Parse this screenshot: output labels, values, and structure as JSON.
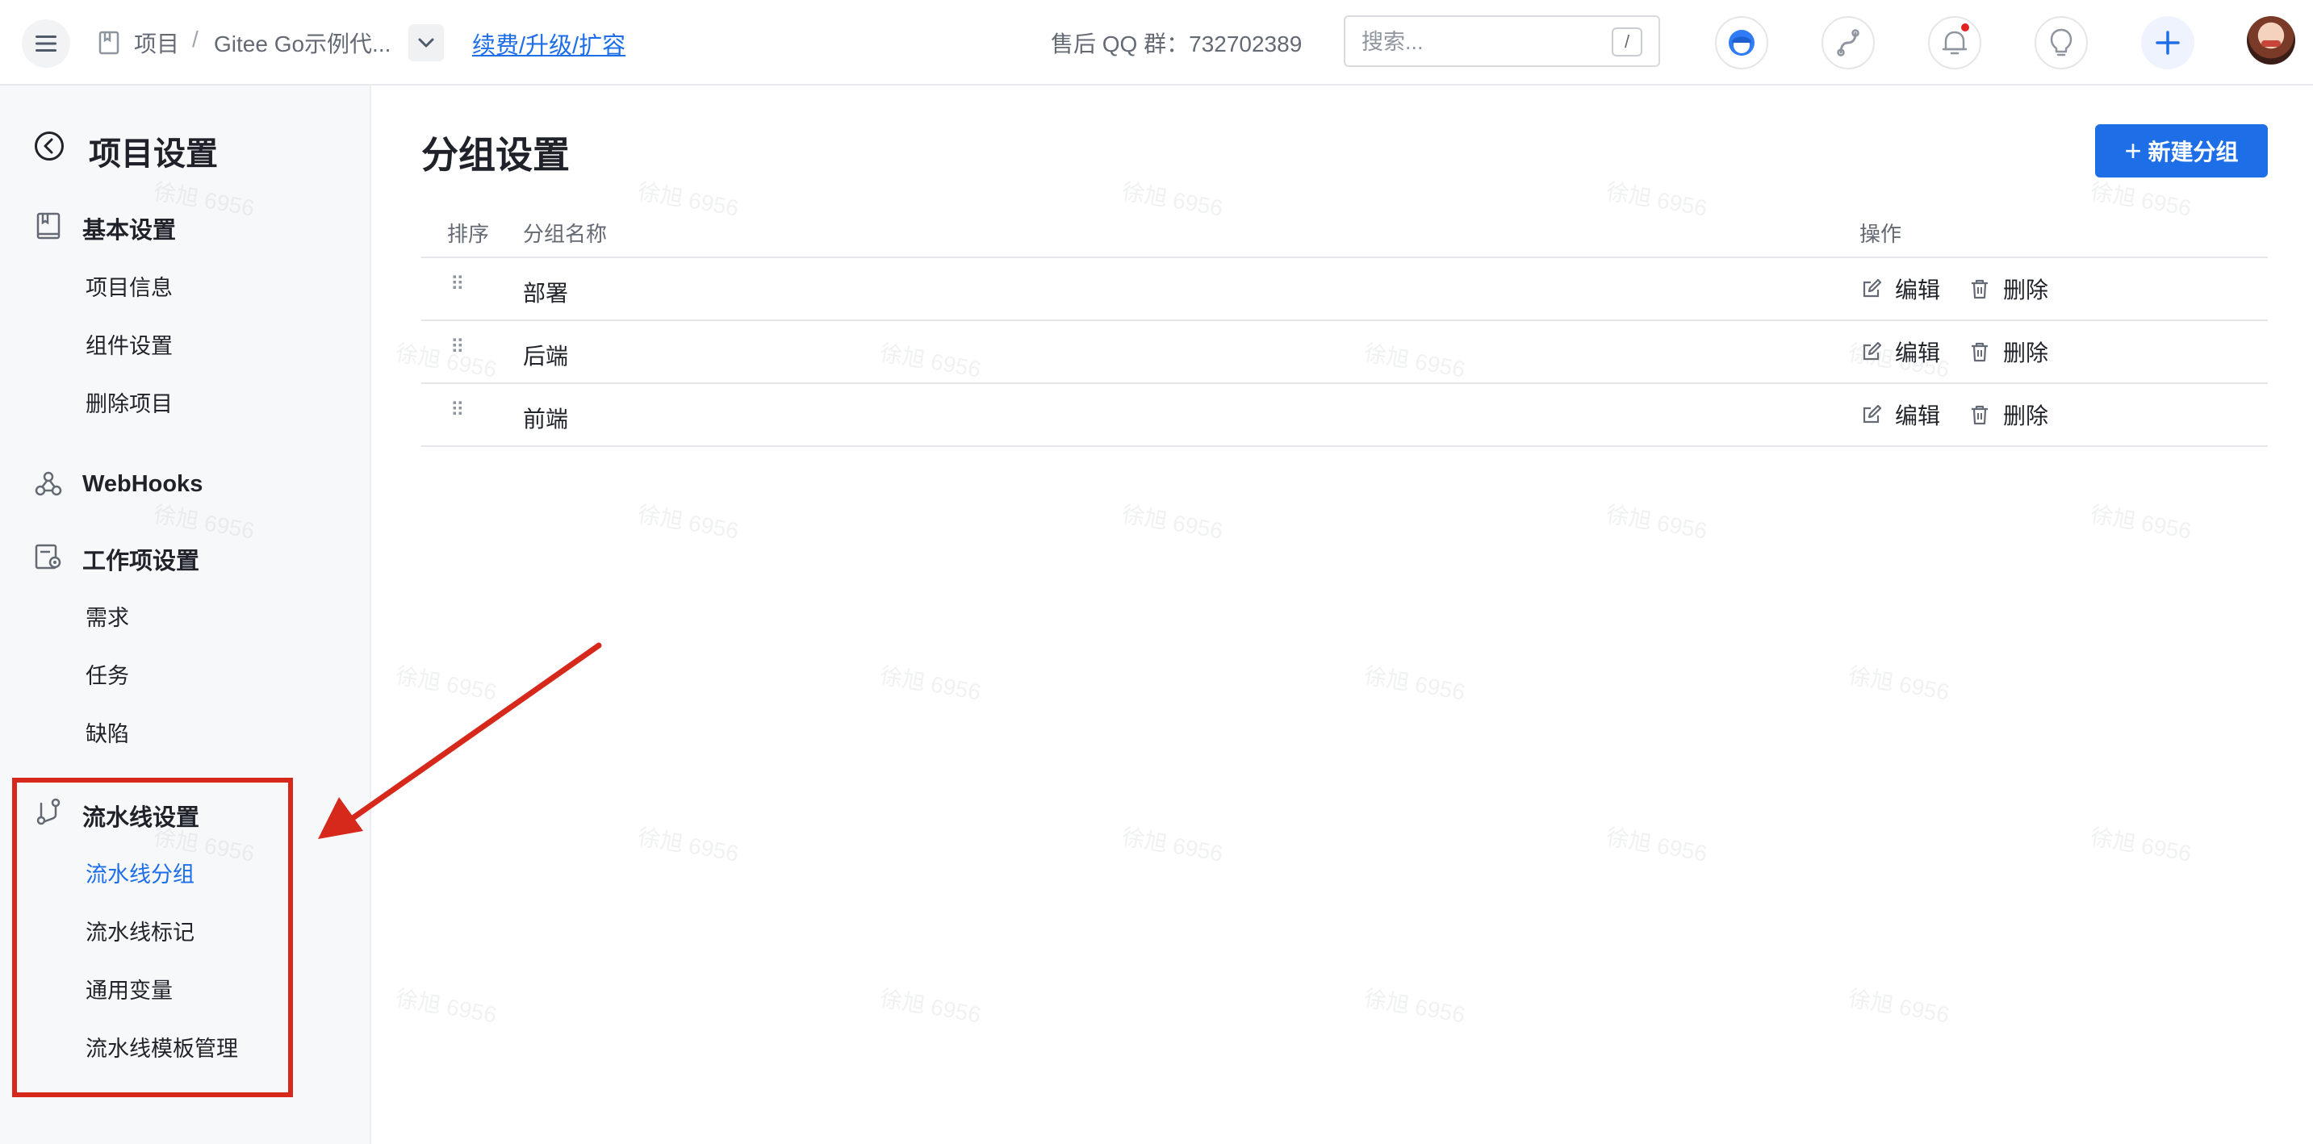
{
  "header": {
    "breadcrumb_root": "项目",
    "breadcrumb_sep": "/",
    "project_name": "Gitee Go示例代...",
    "renew_link": "续费/升级/扩容",
    "qq_group": "售后 QQ 群：732702389",
    "search_placeholder": "搜索...",
    "search_shortcut": "/"
  },
  "sidebar": {
    "title": "项目设置",
    "groups": [
      {
        "label": "基本设置",
        "icon": "book-icon",
        "items": [
          "项目信息",
          "组件设置",
          "删除项目"
        ]
      },
      {
        "label": "WebHooks",
        "icon": "webhook-icon",
        "items": []
      },
      {
        "label": "工作项设置",
        "icon": "workitem-settings-icon",
        "items": [
          "需求",
          "任务",
          "缺陷"
        ]
      },
      {
        "label": "流水线设置",
        "icon": "pipeline-icon",
        "items": [
          "流水线分组",
          "流水线标记",
          "通用变量",
          "流水线模板管理"
        ]
      }
    ],
    "active_item": "流水线分组"
  },
  "main": {
    "title": "分组设置",
    "new_button": "新建分组",
    "columns": {
      "order": "排序",
      "name": "分组名称",
      "actions": "操作"
    },
    "rows": [
      {
        "name": "部署"
      },
      {
        "name": "后端"
      },
      {
        "name": "前端"
      }
    ],
    "edit_label": "编辑",
    "delete_label": "删除",
    "drag_glyph": "⠿"
  },
  "watermark": "徐旭 6956",
  "colors": {
    "primary": "#1e6ee8",
    "annotation": "#d6291c",
    "notification": "#e02424"
  }
}
